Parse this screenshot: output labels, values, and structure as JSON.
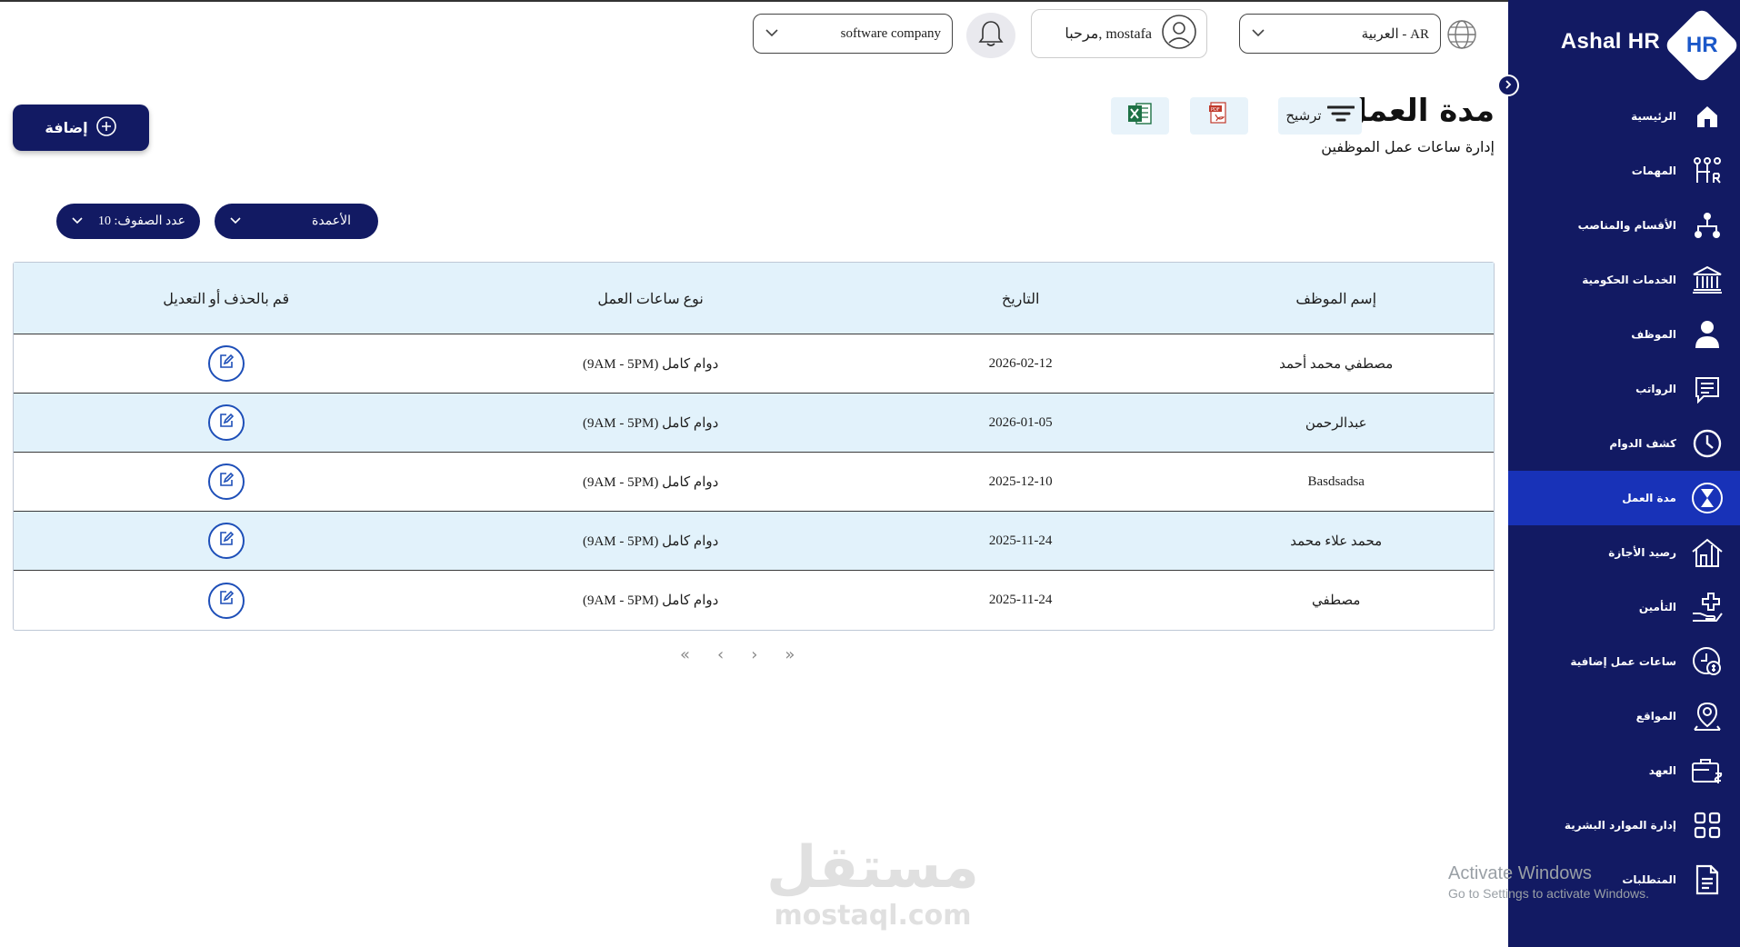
{
  "app": {
    "name": "Ashal HR",
    "logo_mark": "HR"
  },
  "header": {
    "company_select": "software company",
    "user_greeting": "مرحبا, mostafa",
    "language_select": "العربية - AR"
  },
  "page": {
    "title": "مدة العمل",
    "subtitle": "إدارة ساعات عمل الموظفين",
    "filter_label": "ترشيح",
    "add_label": "إضافة"
  },
  "controls": {
    "rows_select": "عدد الصفوف: 10",
    "columns_select": "الأعمدة"
  },
  "table": {
    "headers": [
      "إسم الموظف",
      "التاريخ",
      "نوع ساعات العمل",
      "قم بالحذف أو التعديل"
    ],
    "rows": [
      {
        "name": "مصطفي محمد أحمد",
        "date": "2026-02-12",
        "type": "دوام كامل (9AM - 5PM)"
      },
      {
        "name": "عبدالرحمن",
        "date": "2026-01-05",
        "type": "دوام كامل (9AM - 5PM)"
      },
      {
        "name": "Basdsadsa",
        "date": "2025-12-10",
        "type": "دوام كامل (9AM - 5PM)"
      },
      {
        "name": "محمد علاء محمد",
        "date": "2025-11-24",
        "type": "دوام كامل (9AM - 5PM)"
      },
      {
        "name": "مصطفي",
        "date": "2025-11-24",
        "type": "دوام كامل (9AM - 5PM)"
      }
    ]
  },
  "pagination": {
    "first": "«",
    "prev": "‹",
    "next": "›",
    "last": "»"
  },
  "sidebar": {
    "items": [
      {
        "label": "الرئيسية",
        "icon": "home-icon"
      },
      {
        "label": "المهمات",
        "icon": "tasks-icon"
      },
      {
        "label": "الأقسام والمناصب",
        "icon": "org-chart-icon"
      },
      {
        "label": "الخدمات الحكومية",
        "icon": "bank-icon"
      },
      {
        "label": "الموظف",
        "icon": "user-icon"
      },
      {
        "label": "الرواتب",
        "icon": "receipt-icon"
      },
      {
        "label": "كشف الدوام",
        "icon": "clock-icon"
      },
      {
        "label": "مدة العمل",
        "icon": "hourglass-icon"
      },
      {
        "label": "رصيد الأجازة",
        "icon": "house-icon"
      },
      {
        "label": "التأمين",
        "icon": "hand-plus-icon"
      },
      {
        "label": "ساعات عمل إضافية",
        "icon": "clock-money-icon"
      },
      {
        "label": "المواقع",
        "icon": "location-icon"
      },
      {
        "label": "العهد",
        "icon": "briefcase-icon"
      },
      {
        "label": "إدارة الموارد البشرية",
        "icon": "grid-icon"
      },
      {
        "label": "المتطلبات",
        "icon": "document-icon"
      }
    ],
    "active_index": 7
  },
  "watermark": {
    "arabic": "مستقل",
    "latin": "mostaql.com"
  },
  "os_notice": {
    "title": "Activate Windows",
    "body": "Go to Settings to activate Windows."
  },
  "colors": {
    "sidebar": "#121a63",
    "active": "#1832b8",
    "row_highlight": "#e2f2fb",
    "edit_icon": "#1e4fb8"
  }
}
